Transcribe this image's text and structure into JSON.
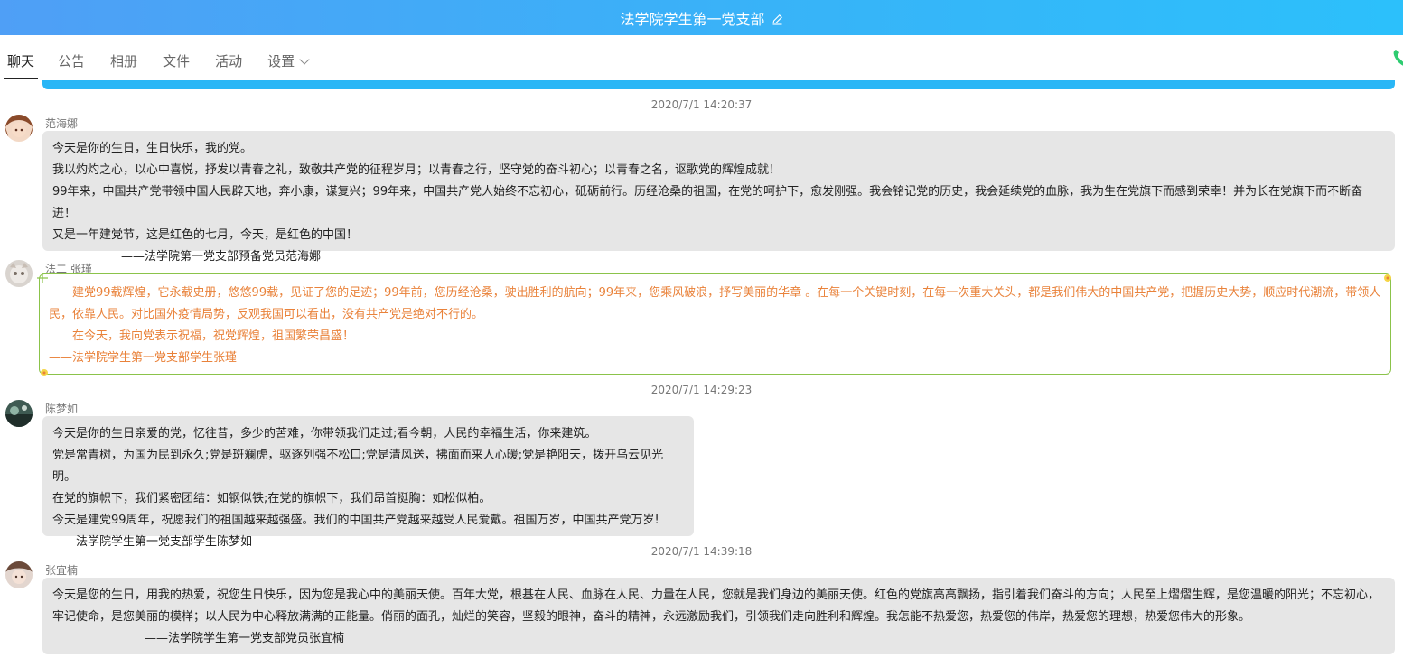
{
  "header": {
    "title": "法学院学生第一党支部"
  },
  "tabs": [
    {
      "label": "聊天",
      "active": true
    },
    {
      "label": "公告"
    },
    {
      "label": "相册"
    },
    {
      "label": "文件"
    },
    {
      "label": "活动"
    },
    {
      "label": "设置"
    }
  ],
  "icons": {
    "edit": "edit-icon",
    "phone": "phone-icon",
    "dropdown": "chevron-down-icon"
  },
  "colors": {
    "header": "#38b3f8",
    "accent_bar": "#29b6f6",
    "flower_border": "#8bc34a",
    "flower_text": "#e9823a",
    "phone": "#2ecc71"
  },
  "timestamps": [
    "2020/7/1 14:20:37",
    "2020/7/1 14:29:23",
    "2020/7/1 14:39:18"
  ],
  "messages": [
    {
      "sender": "范海娜",
      "lines": [
        "今天是你的生日，生日快乐，我的党。",
        "我以灼灼之心，以心中喜悦，抒发以青春之礼，致敬共产党的征程岁月；以青春之行，坚守党的奋斗初心；以青春之名，讴歌党的辉煌成就！",
        "99年来，中国共产党带领中国人民辟天地，奔小康，谋复兴；99年来，中国共产党人始终不忘初心，砥砺前行。历经沧桑的祖国，在党的呵护下，愈发刚强。我会铭记党的历史，我会延续党的血脉，我为生在党旗下而感到荣幸！并为长在党旗下而不断奋进！",
        "又是一年建党节，这是红色的七月，今天，是红色的中国！",
        "——法学院第一党支部预备党员范海娜"
      ]
    },
    {
      "sender": "法二 张瑾",
      "lines": [
        "建党99载辉煌，它永载史册，悠悠99载，见证了您的足迹；99年前，您历经沧桑，驶出胜利的航向；99年来，您乘风破浪，抒写美丽的华章 。在每一个关键时刻，在每一次重大关头，都是我们伟大的中国共产党，把握历史大势，顺应时代潮流，带领人民，依靠人民。对比国外疫情局势，反观我国可以看出，没有共产党是绝对不行的。",
        "在今天，我向党表示祝福，祝党辉煌，祖国繁荣昌盛！",
        "——法学院学生第一党支部学生张瑾"
      ]
    },
    {
      "sender": "陈梦如",
      "lines": [
        "今天是你的生日亲爱的党，忆往昔，多少的苦难，你带领我们走过;看今朝，人民的幸福生活，你来建筑。",
        "党是常青树，为国为民到永久;党是斑斓虎，驱逐列强不松口;党是清风送，拂面而来人心暖;党是艳阳天，拨开乌云见光明。",
        "在党的旗帜下，我们紧密团结：如钢似铁;在党的旗帜下，我们昂首挺胸：如松似柏。",
        "今天是建党99周年，祝愿我们的祖国越来越强盛。我们的中国共产党越来越受人民爱戴。祖国万岁，中国共产党万岁!",
        "——法学院学生第一党支部学生陈梦如"
      ]
    },
    {
      "sender": "张宜楠",
      "lines": [
        "今天是您的生日，用我的热爱，祝您生日快乐，因为您是我心中的美丽天使。百年大党，根基在人民、血脉在人民、力量在人民，您就是我们身边的美丽天使。红色的党旗高高飘扬，指引着我们奋斗的方向；人民至上熠熠生辉，是您温暖的阳光；不忘初心，",
        "牢记使命，是您美丽的模样；以人民为中心释放满满的正能量。俏丽的面孔，灿烂的笑容，坚毅的眼神，奋斗的精神，永远激励我们，引领我们走向胜利和辉煌。我怎能不热爱您，热爱您的伟岸，热爱您的理想，热爱您伟大的形象。",
        "——法学院学生第一党支部党员张宜楠"
      ]
    }
  ]
}
